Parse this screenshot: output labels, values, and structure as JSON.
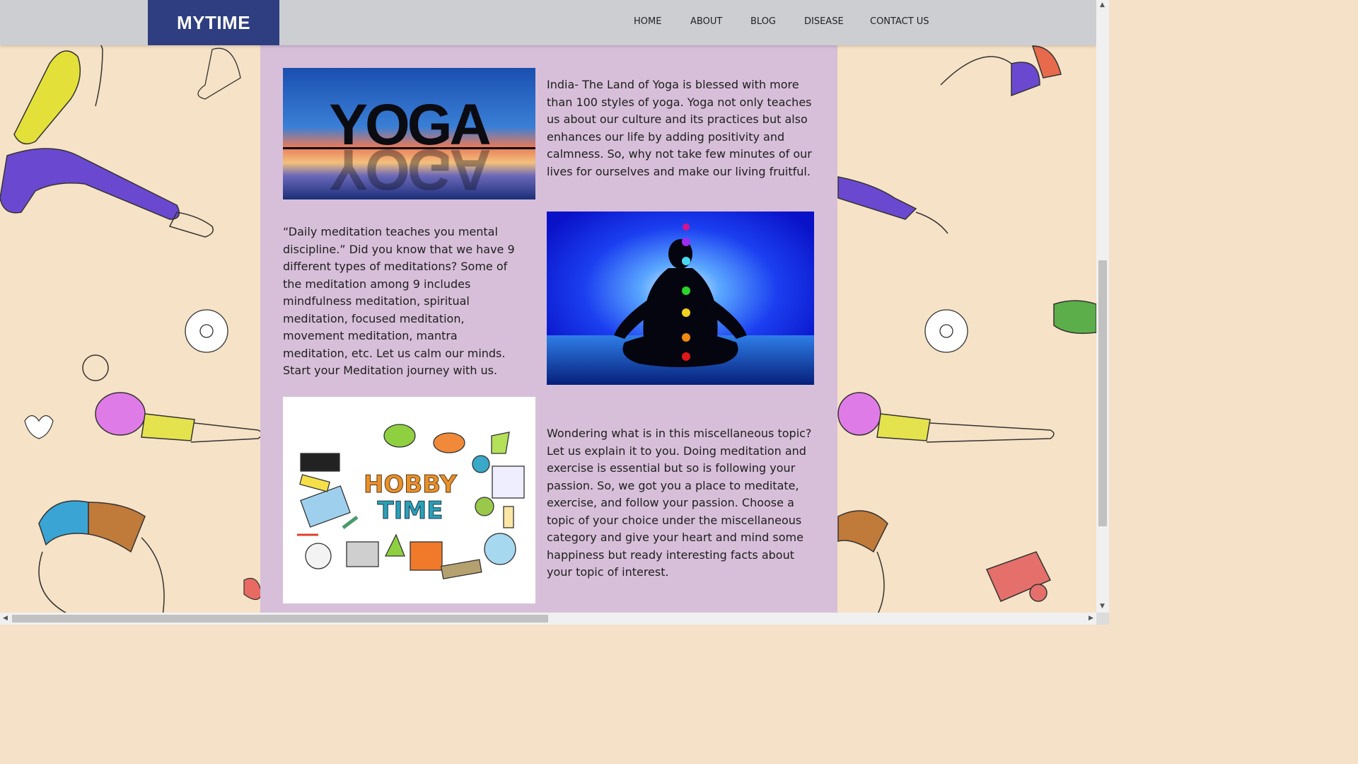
{
  "brand": "MYTIME",
  "nav": {
    "items": [
      "HOME",
      "ABOUT",
      "BLOG",
      "DISEASE",
      "CONTACT US"
    ]
  },
  "sections": [
    {
      "image_caption": "YOGA",
      "text": "India- The Land of Yoga is blessed with more than 100 styles of yoga. Yoga not only teaches us about our culture and its practices but also enhances our life by adding positivity and calmness. So, why not take few minutes of our lives for ourselves and make our living fruitful."
    },
    {
      "text": "“Daily meditation teaches you mental discipline.” Did you know that we have 9 different types of meditations? Some of the meditation among 9 includes mindfulness meditation, spiritual meditation, focused meditation, movement meditation, mantra meditation, etc. Let us calm our minds. Start your Meditation journey with us."
    },
    {
      "image_caption_1": "HOBBY",
      "image_caption_2": "TIME",
      "text": "Wondering what is in this miscellaneous topic? Let us explain it to you. Doing meditation and exercise is essential but so is following your passion. So, we got you a place to meditate, exercise, and follow your passion. Choose a topic of your choice under the miscellaneous category and give your heart and mind some happiness but ready interesting facts about your topic of interest."
    }
  ],
  "colors": {
    "nav_bg": "#cdced2",
    "logo_bg": "#2f3e80",
    "panel_bg": "#d7bfd9",
    "page_bg": "#f6e2c6"
  },
  "icons": [
    "chakra-meditation-image",
    "yoga-sunset-image",
    "hobby-doodles-image"
  ]
}
